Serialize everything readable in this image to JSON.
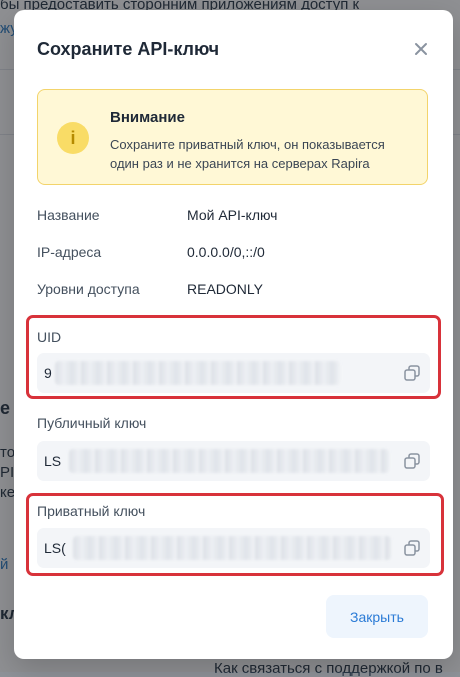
{
  "background": {
    "top_text_prefix": "бы предоставить сторонним приложениям доступ к",
    "top_link_fragment": "жу",
    "side_fragment_1": "е в",
    "side_fragment_2": "то",
    "side_fragment_3": "PI,",
    "side_fragment_4": "ке",
    "side_link_fragment": "й",
    "side_fragment_5": "кл",
    "bottom_text": "Как связаться с поддержкой по в"
  },
  "modal": {
    "title": "Сохраните API-ключ",
    "close_icon": "close-icon",
    "warning": {
      "icon": "info-icon",
      "icon_glyph": "i",
      "title": "Внимание",
      "text": "Сохраните приватный ключ, он показывается один раз и не хранится на серверах Rapira"
    },
    "info": [
      {
        "label": "Название",
        "value": "Мой API-ключ"
      },
      {
        "label": "IP-адреса",
        "value": "0.0.0.0/0,::/0"
      },
      {
        "label": "Уровни доступа",
        "value": "READONLY"
      }
    ],
    "fields": [
      {
        "label": "UID",
        "value_prefix": "9",
        "highlighted": true,
        "copy_icon": "copy-icon"
      },
      {
        "label": "Публичный ключ",
        "value_prefix": "LS",
        "highlighted": false,
        "copy_icon": "copy-icon"
      },
      {
        "label": "Приватный ключ",
        "value_prefix": "LS(",
        "highlighted": true,
        "copy_icon": "copy-icon"
      }
    ],
    "close_button_label": "Закрыть"
  },
  "colors": {
    "accent": "#2b7bd6",
    "highlight_frame": "#d8323a",
    "warning_bg": "#fff8d6",
    "warning_border": "#f3d46b"
  }
}
